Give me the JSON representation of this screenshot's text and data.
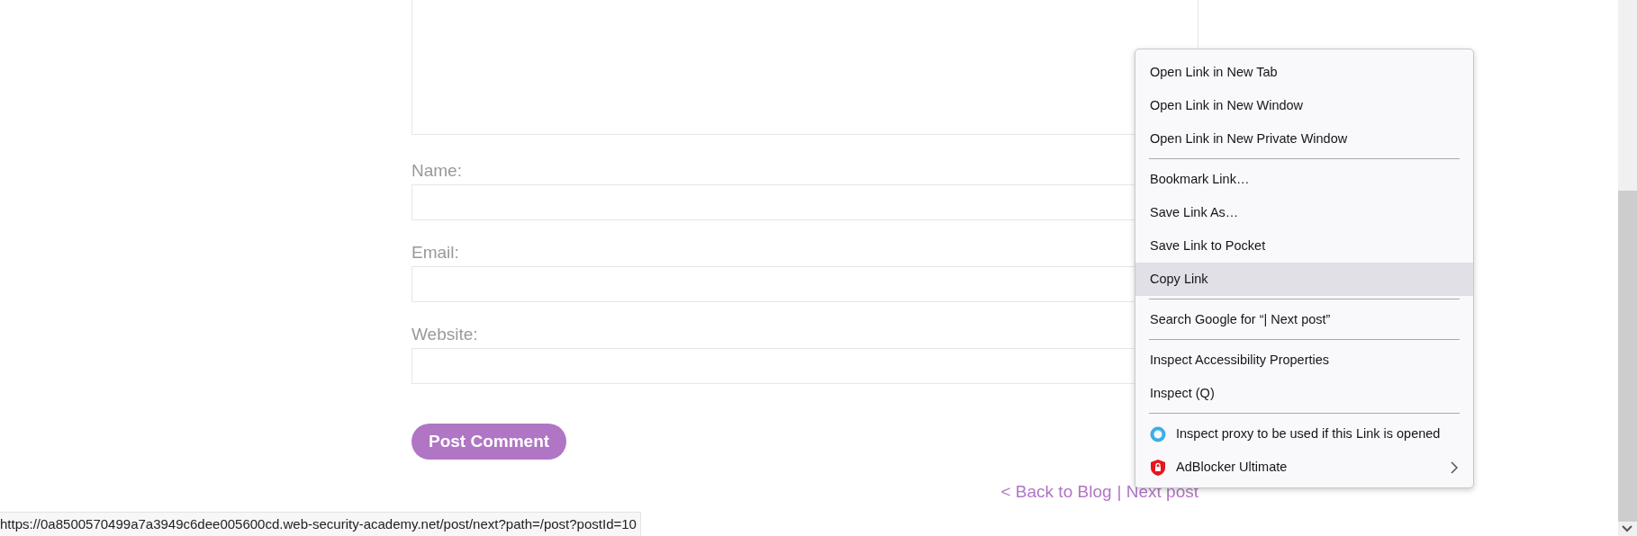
{
  "comment_form": {
    "fields": [
      {
        "label": "Name:"
      },
      {
        "label": "Email:"
      },
      {
        "label": "Website:"
      }
    ],
    "submit_button": "Post Comment"
  },
  "nav_links": [
    "< Back to Blog",
    "| Next post"
  ],
  "context_menu": {
    "items": [
      {
        "kind": "item",
        "label": "Open Link in New Tab",
        "selected": false
      },
      {
        "kind": "item",
        "label": "Open Link in New Window",
        "selected": false
      },
      {
        "kind": "item",
        "label": "Open Link in New Private Window",
        "selected": false
      },
      {
        "kind": "separator"
      },
      {
        "kind": "item",
        "label": "Bookmark Link…",
        "selected": false
      },
      {
        "kind": "item",
        "label": "Save Link As…",
        "selected": false
      },
      {
        "kind": "item",
        "label": "Save Link to Pocket",
        "selected": false
      },
      {
        "kind": "item",
        "label": "Copy Link",
        "selected": true
      },
      {
        "kind": "separator"
      },
      {
        "kind": "item",
        "label": "Search Google for “| Next post”",
        "selected": false
      },
      {
        "kind": "separator"
      },
      {
        "kind": "item",
        "label": "Inspect Accessibility Properties",
        "selected": false
      },
      {
        "kind": "item",
        "label": "Inspect (Q)",
        "selected": false
      },
      {
        "kind": "separator"
      },
      {
        "kind": "proxy-extension",
        "label": "Inspect proxy to be used if this Link is opened",
        "submenu": false,
        "selected": false
      },
      {
        "kind": "adblock-extension",
        "label": "AdBlocker Ultimate",
        "submenu": true,
        "selected": false
      }
    ]
  },
  "status_bar": {
    "url": "https://0a8500570499a7a3949c6dee005600cd.web-security-academy.net/post/next?path=/post?postId=10"
  }
}
